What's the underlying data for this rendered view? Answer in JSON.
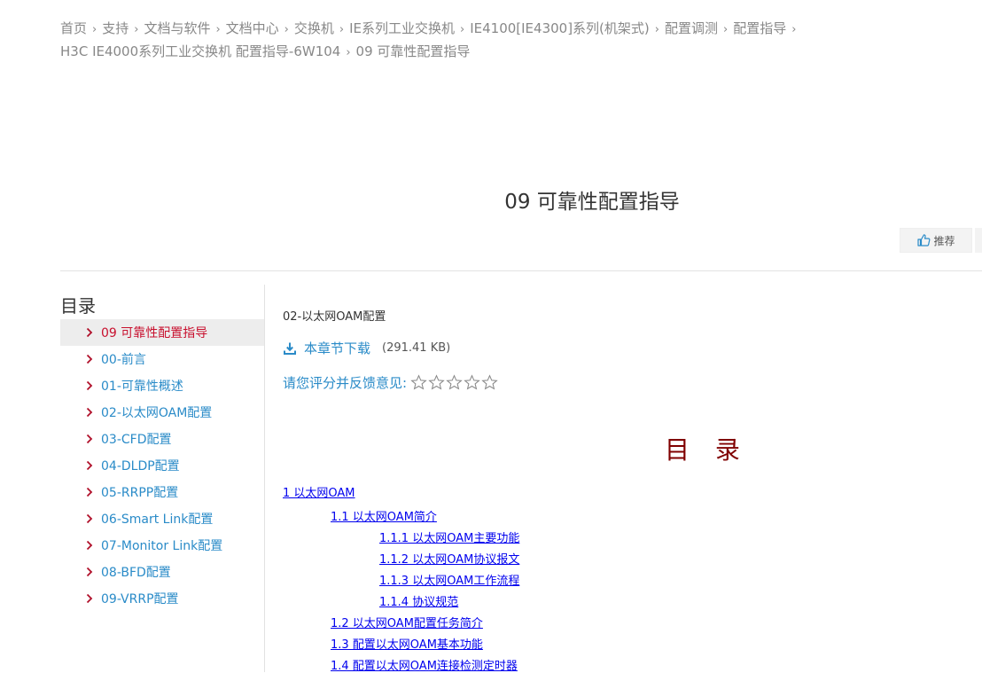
{
  "breadcrumb": [
    "首页",
    "支持",
    "文档与软件",
    "文档中心",
    "交换机",
    "IE系列工业交换机",
    "IE4100[IE4300]系列(机架式)",
    "配置调测",
    "配置指导",
    "H3C IE4000系列工业交换机 配置指导-6W104",
    "09 可靠性配置指导"
  ],
  "page_title": "09 可靠性配置指导",
  "recommend_label": "推荐",
  "sidebar": {
    "heading": "目录",
    "items": [
      "09 可靠性配置指导",
      "00-前言",
      "01-可靠性概述",
      "02-以太网OAM配置",
      "03-CFD配置",
      "04-DLDP配置",
      "05-RRPP配置",
      "06-Smart Link配置",
      "07-Monitor Link配置",
      "08-BFD配置",
      "09-VRRP配置"
    ],
    "active_index": 0
  },
  "content": {
    "doc_name": "02-以太网OAM配置",
    "download_label": "本章节下载",
    "file_size": "(291.41 KB)",
    "rating_label": "请您评分并反馈意见:",
    "rating_value": 0,
    "rating_max": 5,
    "toc_title": "目  录",
    "toc": [
      "1 以太网OAM",
      "1.1 以太网OAM简介",
      "1.1.1 以太网OAM主要功能",
      "1.1.2 以太网OAM协议报文",
      "1.1.3 以太网OAM工作流程",
      "1.1.4 协议规范",
      "1.2 以太网OAM配置任务简介",
      "1.3 配置以太网OAM基本功能",
      "1.4 配置以太网OAM连接检测定时器"
    ]
  },
  "colors": {
    "link": "#2a8bc8",
    "active": "#c8102e",
    "toc_title": "#800000",
    "toc_link": "#0000ee"
  }
}
